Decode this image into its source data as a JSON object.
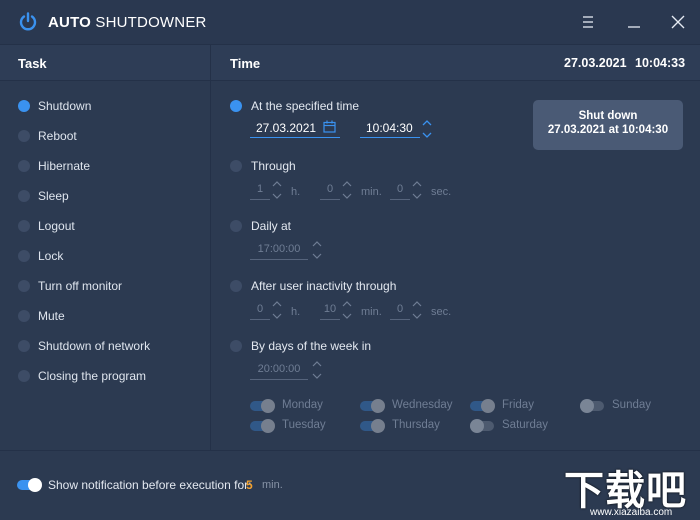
{
  "app": {
    "title_bold": "AUTO",
    "title_rest": " SHUTDOWNER"
  },
  "header": {
    "task_label": "Task",
    "time_label": "Time",
    "current_date": "27.03.2021",
    "current_time": "10:04:33"
  },
  "tasks": [
    {
      "label": "Shutdown",
      "selected": true
    },
    {
      "label": "Reboot",
      "selected": false
    },
    {
      "label": "Hibernate",
      "selected": false
    },
    {
      "label": "Sleep",
      "selected": false
    },
    {
      "label": "Logout",
      "selected": false
    },
    {
      "label": "Lock",
      "selected": false
    },
    {
      "label": "Turn off monitor",
      "selected": false
    },
    {
      "label": "Mute",
      "selected": false
    },
    {
      "label": "Shutdown of network",
      "selected": false
    },
    {
      "label": "Closing the program",
      "selected": false
    }
  ],
  "time_options": {
    "specified": {
      "label": "At the specified time",
      "date": "27.03.2021",
      "time": "10:04:30",
      "selected": true
    },
    "through": {
      "label": "Through",
      "hours": "1",
      "minutes": "0",
      "seconds": "0",
      "unit_h": "h.",
      "unit_min": "min.",
      "unit_sec": "sec."
    },
    "daily": {
      "label": "Daily at",
      "time": "17:00:00"
    },
    "inactivity": {
      "label": "After user inactivity through",
      "hours": "0",
      "minutes": "10",
      "seconds": "0",
      "unit_h": "h.",
      "unit_min": "min.",
      "unit_sec": "sec."
    },
    "weekdays": {
      "label": "By days of the week in",
      "time": "20:00:00"
    }
  },
  "days": {
    "monday": "Monday",
    "tuesday": "Tuesday",
    "wednesday": "Wednesday",
    "thursday": "Thursday",
    "friday": "Friday",
    "saturday": "Saturday",
    "sunday": "Sunday"
  },
  "action_button": {
    "line1": "Shut down",
    "line2": "27.03.2021 at 10:04:30"
  },
  "notification": {
    "enabled": true,
    "label": "Show notification before execution for:",
    "value": "5",
    "unit": "min."
  },
  "watermark": {
    "main": "下载吧",
    "url": "www.xiazaiba.com"
  },
  "colors": {
    "accent": "#3a92f0",
    "background": "#2c3a51",
    "notify_value": "#f0a030"
  }
}
